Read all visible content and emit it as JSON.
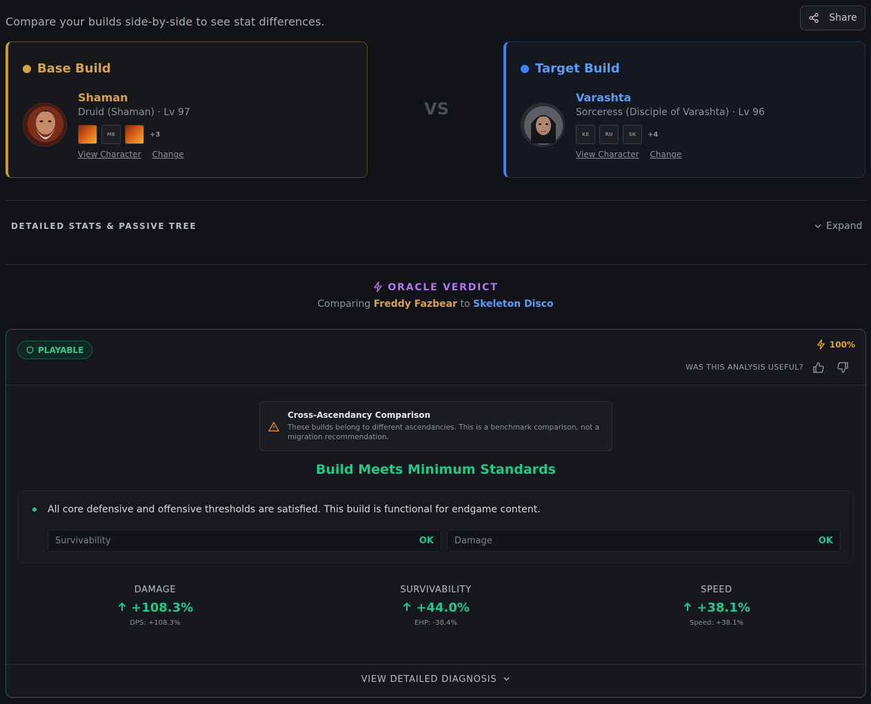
{
  "header": {
    "intro": "Compare your builds side-by-side to see stat differences.",
    "share_label": "Share"
  },
  "base_build": {
    "heading": "Base Build",
    "name": "Shaman",
    "class_line": "Druid (Shaman) · Lv 97",
    "skills": [
      "",
      "ME",
      ""
    ],
    "more_skills": "+3",
    "view_label": "View Character",
    "change_label": "Change",
    "accent_color": "#d6a24a"
  },
  "vs_label": "VS",
  "target_build": {
    "heading": "Target Build",
    "name": "Varashta",
    "class_line": "Sorceress (Disciple of Varashta) · Lv 96",
    "skills": [
      "KE",
      "RU",
      "SK"
    ],
    "more_skills": "+4",
    "view_label": "View Character",
    "change_label": "Change",
    "accent_color": "#3b82f6"
  },
  "details": {
    "label": "DETAILED STATS & PASSIVE TREE",
    "expand_label": "Expand"
  },
  "oracle": {
    "title": "ORACLE VERDICT",
    "comparing_prefix": "Comparing",
    "base_name": "Freddy Fazbear",
    "joiner": "to",
    "target_name": "Skeleton Disco"
  },
  "verdict": {
    "badge": "PLAYABLE",
    "score": "100%",
    "useful_prompt": "WAS THIS ANALYSIS USEFUL?",
    "notice_title": "Cross-Ascendancy Comparison",
    "notice_text": "These builds belong to different ascendancies. This is a benchmark comparison, not a migration recommendation.",
    "headline": "Build Meets Minimum Standards",
    "check_text": "All core defensive and offensive thresholds are satisfied. This build is functional for endgame content.",
    "metrics": [
      {
        "label": "Survivability",
        "status": "OK"
      },
      {
        "label": "Damage",
        "status": "OK"
      }
    ],
    "stats": [
      {
        "label": "DAMAGE",
        "value": "+108.3%",
        "sub": "DPS: +108.3%"
      },
      {
        "label": "SURVIVABILITY",
        "value": "+44.0%",
        "sub": "EHP: -38.4%"
      },
      {
        "label": "SPEED",
        "value": "+38.1%",
        "sub": "Speed: +38.1%"
      }
    ],
    "diagnosis_label": "VIEW DETAILED DIAGNOSIS",
    "accent_color": "#20c98a"
  }
}
